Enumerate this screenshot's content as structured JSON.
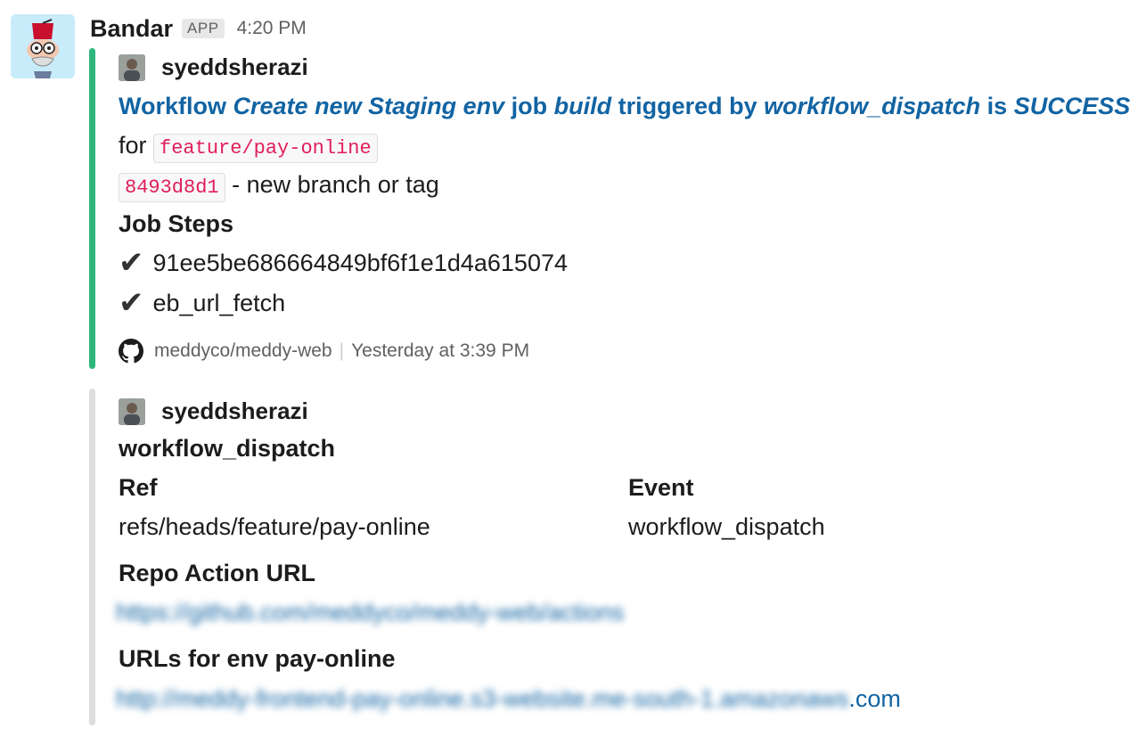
{
  "message": {
    "bot_name": "Bandar",
    "app_badge": "APP",
    "timestamp": "4:20 PM"
  },
  "attachment1": {
    "author": "syeddsherazi",
    "title": {
      "p1": "Workflow ",
      "p2": "Create new Staging env",
      "p3": " job ",
      "p4": "build",
      "p5": " triggered by ",
      "p6": "workflow_dispatch",
      "p7": " is ",
      "p8": "SUCCESS"
    },
    "for_label": "for",
    "branch": "feature/pay-online",
    "commit": "8493d8d1",
    "commit_note": "- new branch or tag",
    "steps_heading": "Job Steps",
    "steps": [
      "91ee5be686664849bf6f1e1d4a615074",
      "eb_url_fetch"
    ],
    "footer_repo": "meddyco/meddy-web",
    "footer_time": "Yesterday at 3:39 PM",
    "bar_color": "#2eb67d"
  },
  "attachment2": {
    "author": "syeddsherazi",
    "heading": "workflow_dispatch",
    "fields": [
      {
        "title": "Ref",
        "value": "refs/heads/feature/pay-online"
      },
      {
        "title": "Event",
        "value": "workflow_dispatch"
      }
    ],
    "repo_action_title": "Repo Action URL",
    "repo_action_url": "https://github.com/meddyco/meddy-web/actions",
    "env_urls_title": "URLs for env pay-online",
    "env_url_blurred": "http://meddy-frontend-pay-online.s3-website.me-south-1.amazonaws",
    "env_url_tail": ".com",
    "bar_color": "#dddddd"
  }
}
